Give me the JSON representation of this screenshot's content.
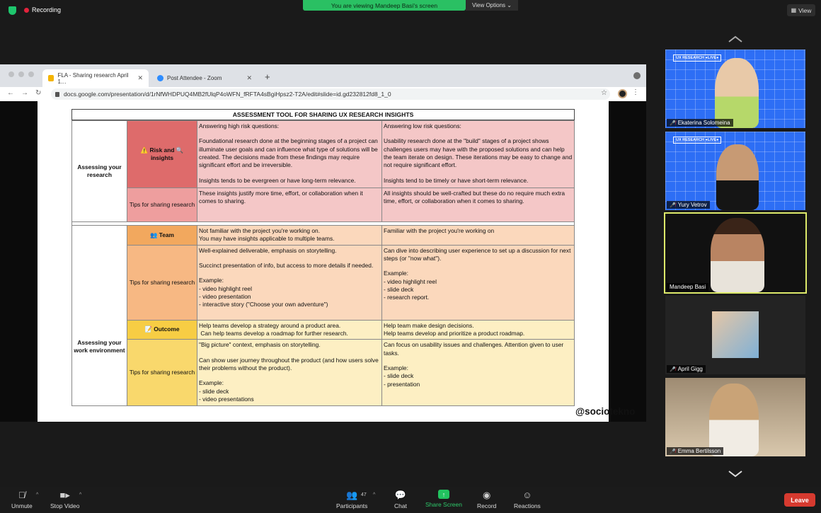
{
  "topbar": {
    "recording_label": "Recording",
    "viewing_banner": "You are viewing Mandeep Basi's screen",
    "view_options": "View Options ⌄",
    "view_button": "View"
  },
  "browser": {
    "tabs": [
      {
        "label": "FLA - Sharing research April 1…",
        "icon_color": "#f4b400"
      },
      {
        "label": "Post Attendee - Zoom",
        "icon_color": "#2d8cff"
      }
    ],
    "url": "docs.google.com/presentation/d/1rNfWHDPUQ4MB2fUlqP4oWFN_fRFTA4sBgiHpsz2-T2A/edit#slide=id.gd232812fd8_1_0"
  },
  "slide": {
    "title": "ASSESSMENT TOOL FOR SHARING UX RESEARCH INSIGHTS",
    "handle": "@sociotekno",
    "sections": {
      "research": "Assessing your research",
      "work": "Assessing your work environment"
    },
    "rows": {
      "risk_label": "⚠️ Risk and 🔍 insights",
      "risk_high_1": "Answering high risk questions:",
      "risk_high_2": "Foundational research done at the beginning stages of a project can illuminate user goals and can influence what type of solutions will be created. The decisions made from these findings may require significant effort and be irreversible.",
      "risk_high_3": "Insights tends to be evergreen or have long-term relevance.",
      "risk_low_1": "Answering low risk questions:",
      "risk_low_2": "Usability research done at the \"build\" stages of a project shows challenges users may have with the proposed solutions and can help the team iterate on design. These iterations may be easy to change and not require significant effort.",
      "risk_low_3": "Insights tend to be timely or have short-term relevance.",
      "tips_label": "Tips for sharing research",
      "tips1_high": "These insights justify more time, effort, or collaboration when it comes to sharing.",
      "tips1_low": "All insights should be well-crafted but these do no require much extra time, effort, or collaboration when it comes to sharing.",
      "team_label": "👥 Team",
      "team_high_1": "Not familiar with the project you're working on.",
      "team_high_2": "You may have insights applicable to multiple teams.",
      "team_low": "Familiar with the project you're working on",
      "tips2_high_1": "Well-explained deliverable, emphasis on storytelling.",
      "tips2_high_2": "Succinct presentation of info, but access to more details if needed.",
      "tips2_high_3": "Example:",
      "tips2_high_4": "- video highlight reel",
      "tips2_high_5": "- video presentation",
      "tips2_high_6": "- interactive story (\"Choose your own adventure\")",
      "tips2_low_1": "Can dive into describing user experience to set up a discussion for next steps (or \"now what\").",
      "tips2_low_2": "Example:",
      "tips2_low_3": "- video highlight reel",
      "tips2_low_4": "- slide deck",
      "tips2_low_5": "- research report.",
      "outcome_label": "📝 Outcome",
      "outcome_high_1": "Help teams develop a strategy around a product area.",
      "outcome_high_2": " Can help teams develop a roadmap for further research.",
      "outcome_low_1": "Help team make design decisions.",
      "outcome_low_2": "Help teams develop and prioritize a product roadmap.",
      "tips3_high_1": "\"Big picture\" context, emphasis on storytelling.",
      "tips3_high_2": "Can show user journey throughout the product (and how users solve their problems without the product).",
      "tips3_high_3": "Example:",
      "tips3_high_4": "- slide deck",
      "tips3_high_5": "- video presentations",
      "tips3_low_1": "Can focus on usability issues and challenges. Attention given to user tasks.",
      "tips3_low_2": "Example:",
      "tips3_low_3": "- slide deck",
      "tips3_low_4": "- presentation"
    }
  },
  "participants": [
    {
      "name": "Ekaterina Solomeina",
      "muted": true,
      "badge": "UX RESEARCH ●LIVE●"
    },
    {
      "name": "Yury Vetrov",
      "muted": true,
      "badge": "UX RESEARCH ●LIVE●"
    },
    {
      "name": "Mandeep Basi",
      "muted": false,
      "badge": ""
    },
    {
      "name": "April Gigg",
      "muted": true,
      "badge": ""
    },
    {
      "name": "Emma Bertilsson",
      "muted": true,
      "badge": ""
    }
  ],
  "controls": {
    "unmute": "Unmute",
    "stop_video": "Stop Video",
    "participants": "Participants",
    "participants_count": "47",
    "chat": "Chat",
    "share_screen": "Share Screen",
    "record": "Record",
    "reactions": "Reactions",
    "leave": "Leave"
  }
}
